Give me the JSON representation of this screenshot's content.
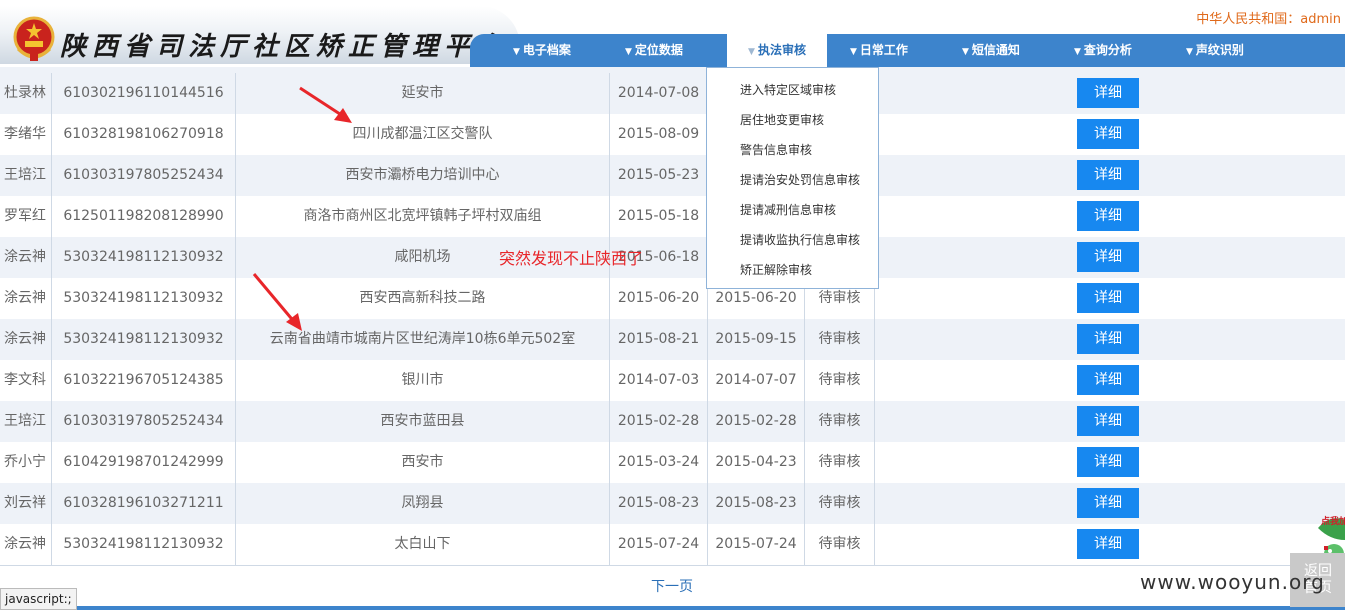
{
  "header": {
    "title": "陕西省司法厅社区矫正管理平台",
    "user_info": "中华人民共和国：admin"
  },
  "nav": {
    "items": [
      {
        "label": "电子档案",
        "icon": "triangle-down-icon"
      },
      {
        "label": "定位数据",
        "icon": "triangle-down-icon"
      },
      {
        "label": "执法审核",
        "icon": "triangle-down-icon",
        "active": true
      },
      {
        "label": "日常工作",
        "icon": "triangle-down-icon"
      },
      {
        "label": "短信通知",
        "icon": "triangle-down-icon"
      },
      {
        "label": "查询分析",
        "icon": "triangle-down-icon"
      },
      {
        "label": "声纹识别",
        "icon": "triangle-down-icon"
      }
    ]
  },
  "dropdown": {
    "items": [
      "进入特定区域审核",
      "居住地变更审核",
      "警告信息审核",
      "提请治安处罚信息审核",
      "提请减刑信息审核",
      "提请收监执行信息审核",
      "矫正解除审核"
    ]
  },
  "table": {
    "button_label": "详细",
    "rows": [
      {
        "name": "杜录林",
        "id": "610302196110144516",
        "addr": "延安市",
        "d1": "2014-07-08",
        "d2": "",
        "status": ""
      },
      {
        "name": "李绪华",
        "id": "610328198106270918",
        "addr": "四川成都温江区交警队",
        "d1": "2015-08-09",
        "d2": "",
        "status": ""
      },
      {
        "name": "王培江",
        "id": "610303197805252434",
        "addr": "西安市灞桥电力培训中心",
        "d1": "2015-05-23",
        "d2": "",
        "status": ""
      },
      {
        "name": "罗军红",
        "id": "612501198208128990",
        "addr": "商洛市商州区北宽坪镇韩子坪村双庙组",
        "d1": "2015-05-18",
        "d2": "",
        "status": ""
      },
      {
        "name": "涂云神",
        "id": "530324198112130932",
        "addr": "咸阳机场",
        "d1": "2015-06-18",
        "d2": "",
        "status": ""
      },
      {
        "name": "涂云神",
        "id": "530324198112130932",
        "addr": "西安西高新科技二路",
        "d1": "2015-06-20",
        "d2": "2015-06-20",
        "status": "待审核"
      },
      {
        "name": "涂云神",
        "id": "530324198112130932",
        "addr": "云南省曲靖市城南片区世纪涛岸10栋6单元502室",
        "d1": "2015-08-21",
        "d2": "2015-09-15",
        "status": "待审核"
      },
      {
        "name": "李文科",
        "id": "610322196705124385",
        "addr": "银川市",
        "d1": "2014-07-03",
        "d2": "2014-07-07",
        "status": "待审核"
      },
      {
        "name": "王培江",
        "id": "610303197805252434",
        "addr": "西安市蓝田县",
        "d1": "2015-02-28",
        "d2": "2015-02-28",
        "status": "待审核"
      },
      {
        "name": "乔小宁",
        "id": "610429198701242999",
        "addr": "西安市",
        "d1": "2015-03-24",
        "d2": "2015-04-23",
        "status": "待审核"
      },
      {
        "name": "刘云祥",
        "id": "610328196103271211",
        "addr": "凤翔县",
        "d1": "2015-08-23",
        "d2": "2015-08-23",
        "status": "待审核"
      },
      {
        "name": "涂云神",
        "id": "530324198112130932",
        "addr": "太白山下",
        "d1": "2015-07-24",
        "d2": "2015-07-24",
        "status": "待审核"
      }
    ]
  },
  "annotation": {
    "text": "突然发现不止陕西了"
  },
  "footer": {
    "next_page": "下一页",
    "status_bar": "javascript:;",
    "back_label_1": "返回",
    "back_label_2": "首页",
    "watermark": "www.wooyun.org",
    "float_label": "点我加"
  },
  "colors": {
    "nav_bg": "#3d84cc",
    "button_bg": "#1788f0",
    "annotation_red": "#e8262a",
    "user_orange": "#e06a1b"
  }
}
